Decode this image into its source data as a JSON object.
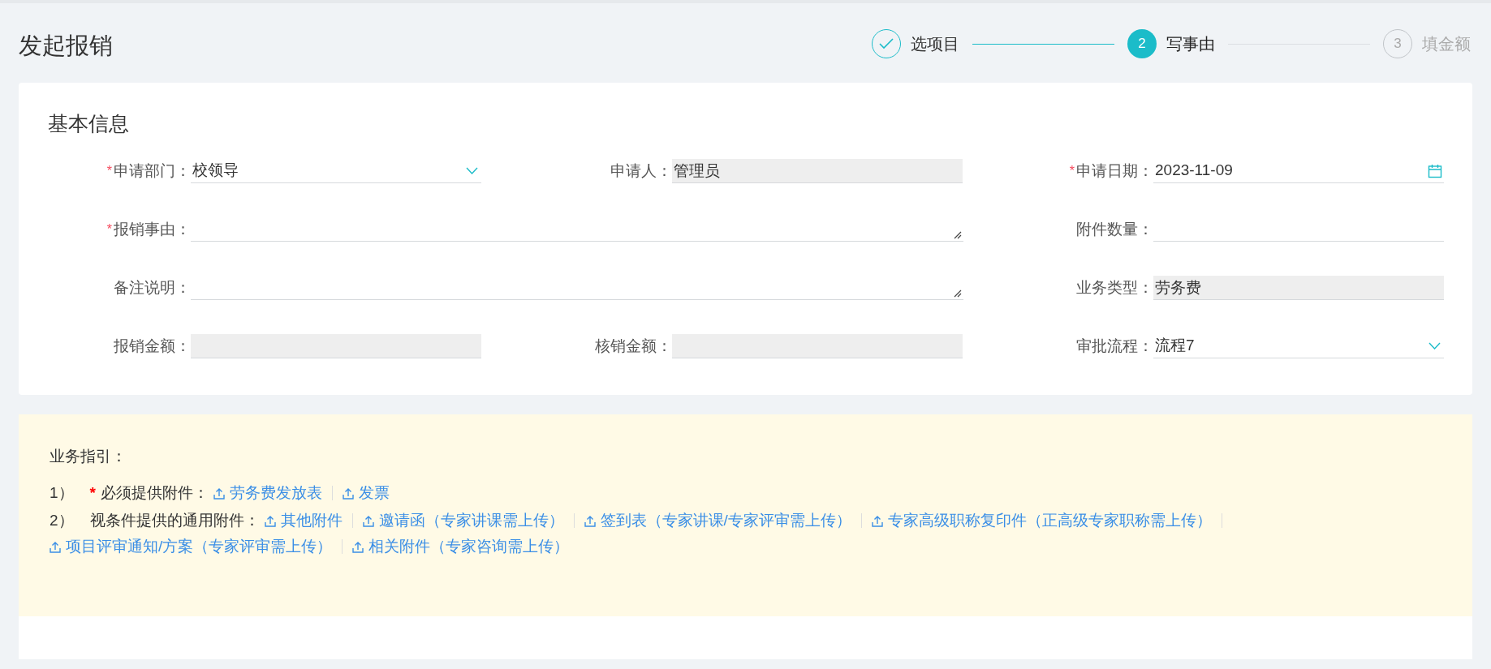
{
  "page_title": "发起报销",
  "steps": [
    {
      "label": "选项目",
      "done": true,
      "selected": false
    },
    {
      "number": "2",
      "label": "写事由",
      "done": false,
      "selected": true
    },
    {
      "number": "3",
      "label": "填金额",
      "done": false,
      "selected": false
    }
  ],
  "basic_info": {
    "title": "基本信息",
    "fields": [
      {
        "required_mark": "*",
        "label": "申请部门：",
        "kind": "select",
        "value": "校领导"
      },
      {
        "label": "申请人：",
        "kind": "readonly",
        "value": "管理员"
      },
      {
        "required_mark": "*",
        "label": "申请日期：",
        "kind": "date",
        "value": "2023-11-09"
      },
      {
        "required_mark": "*",
        "label": "报销事由：",
        "kind": "textarea"
      },
      {
        "label": "附件数量：",
        "kind": "text"
      },
      {
        "label": "备注说明：",
        "kind": "textarea"
      },
      {
        "label": "业务类型：",
        "kind": "readonly",
        "value": "劳务费"
      },
      {
        "label": "报销金额：",
        "kind": "readonly"
      },
      {
        "label": "核销金额：",
        "kind": "readonly"
      },
      {
        "label": "审批流程：",
        "kind": "select",
        "value": "流程7"
      }
    ]
  },
  "guide": {
    "title": "业务指引：",
    "lines": [
      {
        "index": "1）",
        "required_mark": "*",
        "label": "必须提供附件：",
        "attachments": [
          "劳务费发放表",
          "发票"
        ]
      },
      {
        "index": "2）",
        "label": "视条件提供的通用附件：",
        "attachments": [
          "其他附件",
          "邀请函（专家讲课需上传）",
          "签到表（专家讲课/专家评审需上传）",
          "专家高级职称复印件（正高级专家职称需上传）",
          "项目评审通知/方案（专家评审需上传）",
          "相关附件（专家咨询需上传）"
        ]
      }
    ]
  }
}
